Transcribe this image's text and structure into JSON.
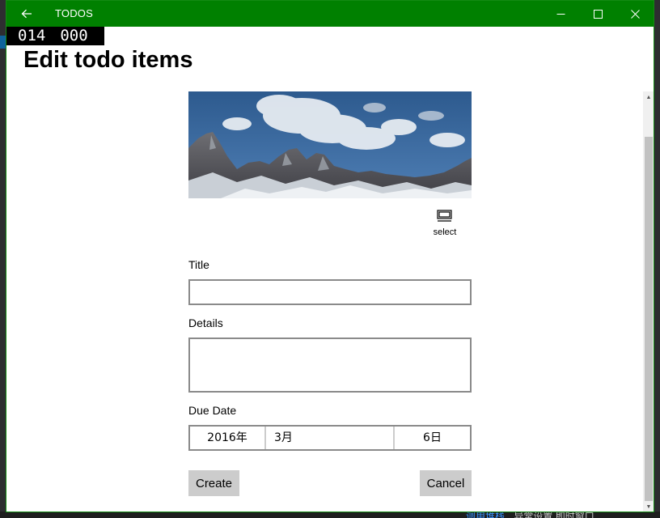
{
  "window": {
    "app_title": "TODOS",
    "titlebar_color": "#008000"
  },
  "frame_counter": {
    "left": "014",
    "right": "000"
  },
  "page": {
    "title": "Edit todo items"
  },
  "image": {
    "description_icon": "mountain-landscape"
  },
  "select_button": {
    "label": "select",
    "icon": "image-select-icon"
  },
  "form": {
    "title_label": "Title",
    "title_value": "",
    "details_label": "Details",
    "details_value": "",
    "due_date_label": "Due Date",
    "due_date": {
      "year": "2016年",
      "month": "3月",
      "day": "6日"
    },
    "create_label": "Create",
    "cancel_label": "Cancel"
  },
  "background": {
    "bottom_link": "调用堆栈",
    "bottom_items": "异常设置  即时窗口"
  }
}
